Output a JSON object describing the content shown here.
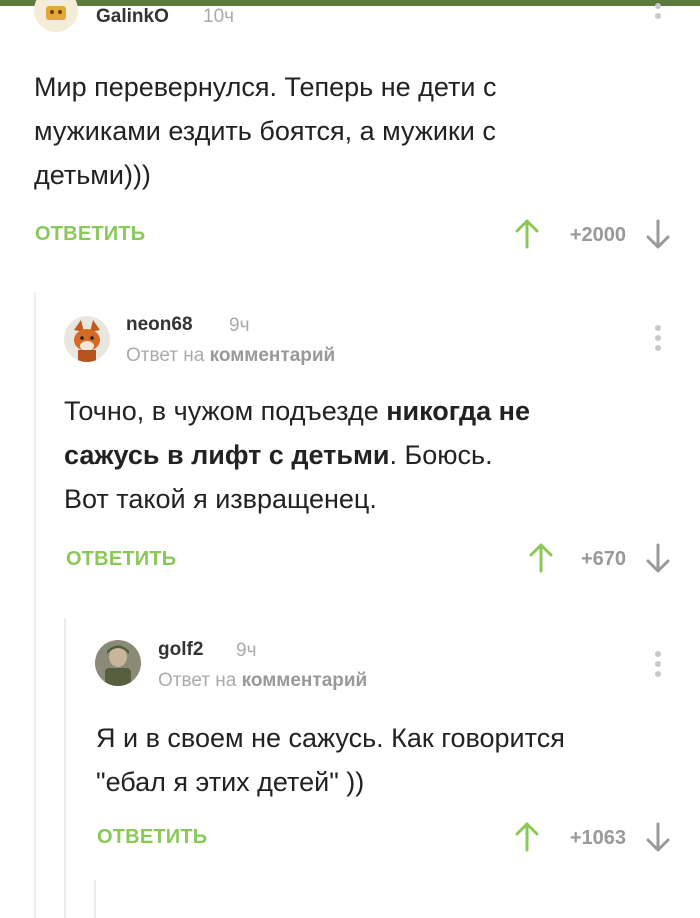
{
  "colors": {
    "accent_green": "#8ac858",
    "top_bar": "#5d7a3d",
    "muted": "#aaaaaa",
    "thread_line": "#ececec"
  },
  "comments": [
    {
      "username": "GalinkO",
      "time": "10ч",
      "text_lines": [
        "Мир перевернулся. Теперь не дети с",
        "мужиками ездить боятся, а мужики с",
        "детьми)))"
      ],
      "reply_label": "ОТВЕТИТЬ",
      "rating": "+2000",
      "avatar_icon": "cartoon-avatar-icon"
    },
    {
      "username": "neon68",
      "time": "9ч",
      "reply_prefix": "Ответ на",
      "reply_target": "комментарий",
      "text": {
        "line1": "Точно,  в чужом подъезде ",
        "line1_bold": "никогда не",
        "line2_bold": "сажусь в лифт с детьми",
        "line2_rest": ". Боюсь.",
        "line3": "Вот такой я извращенец."
      },
      "reply_label": "ОТВЕТИТЬ",
      "rating": "+670",
      "avatar_icon": "fox-avatar-icon"
    },
    {
      "username": "golf2",
      "time": "9ч",
      "reply_prefix": "Ответ на",
      "reply_target": "комментарий",
      "text_lines": [
        "Я и в своем не сажусь. Как говорится",
        "\"ебал я этих детей\" ))"
      ],
      "reply_label": "ОТВЕТИТЬ",
      "rating": "+1063",
      "avatar_icon": "soldier-avatar-icon"
    }
  ]
}
